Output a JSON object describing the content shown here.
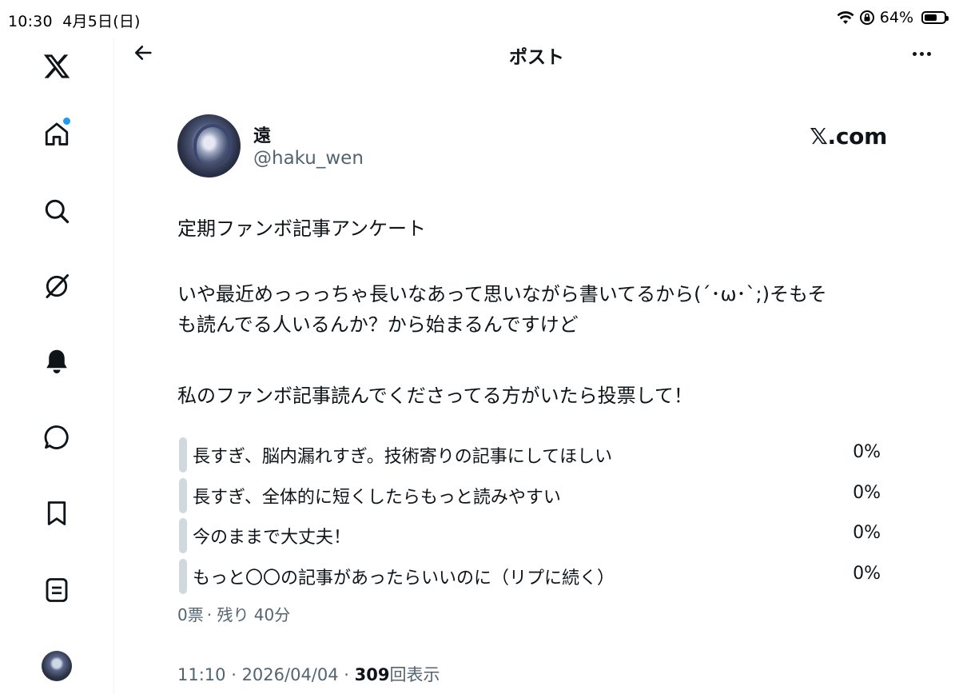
{
  "status_bar": {
    "time": "10:30",
    "date": "4月5日(日)",
    "battery_percent": "64%",
    "battery_level": 0.64
  },
  "sidebar": {
    "items": [
      {
        "name": "x-logo-icon"
      },
      {
        "name": "home-icon",
        "badge": true
      },
      {
        "name": "search-icon"
      },
      {
        "name": "grok-icon"
      },
      {
        "name": "notifications-bell-icon"
      },
      {
        "name": "messages-icon"
      },
      {
        "name": "bookmark-icon"
      },
      {
        "name": "lists-icon"
      }
    ]
  },
  "header": {
    "title": "ポスト"
  },
  "post": {
    "author_name": "遠",
    "author_handle": "@haku_wen",
    "brand": "𝕏.com",
    "text_line1": "定期ファンボ記事アンケート",
    "text_line2": "いや最近めっっっちゃ長いなあって思いながら書いてるから(´･ω･`;)そもそ\nも読んでる人いるんか？から始まるんですけど",
    "text_line3": "私のファンボ記事読んでくださってる方がいたら投票して！",
    "poll": {
      "options": [
        {
          "label": "長すぎ、脳内漏れすぎ。技術寄りの記事にしてほしい",
          "percent": "0%"
        },
        {
          "label": "長すぎ、全体的に短くしたらもっと読みやすい",
          "percent": "0%"
        },
        {
          "label": "今のままで大丈夫！",
          "percent": "0%"
        },
        {
          "label": "もっと〇〇の記事があったらいいのに（リプに続く）",
          "percent": "0%"
        }
      ],
      "votes": "0票",
      "remaining": "残り 40分"
    },
    "time": "11:10",
    "date": "2026/04/04",
    "views_count": "309",
    "views_label": "回表示"
  },
  "colors": {
    "accent": "#1d9bf0",
    "text_primary": "#0f1419",
    "text_secondary": "#536471",
    "poll_bar": "#cfd9de"
  }
}
